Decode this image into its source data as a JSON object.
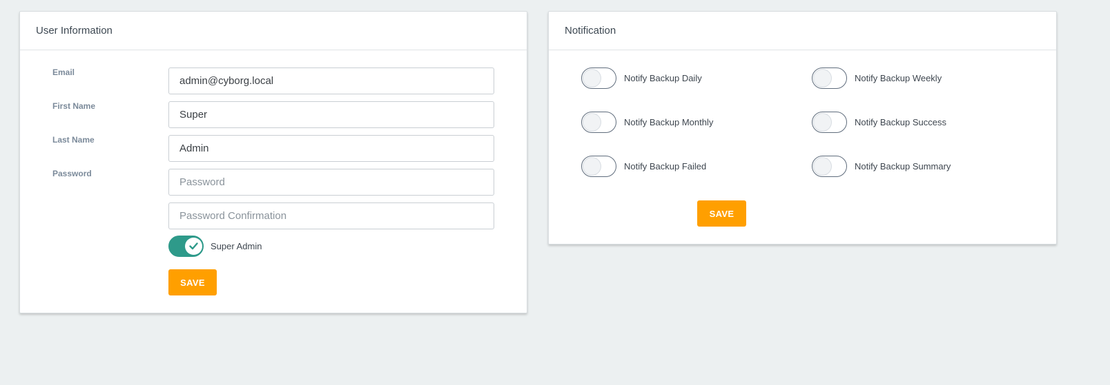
{
  "user_information": {
    "title": "User Information",
    "email": {
      "label": "Email",
      "value": "admin@cyborg.local"
    },
    "first_name": {
      "label": "First Name",
      "value": "Super"
    },
    "last_name": {
      "label": "Last Name",
      "value": "Admin"
    },
    "password": {
      "label": "Password",
      "placeholder": "Password"
    },
    "password_confirmation": {
      "placeholder": "Password Confirmation"
    },
    "super_admin": {
      "label": "Super Admin",
      "checked": true
    },
    "save_label": "SAVE"
  },
  "notification": {
    "title": "Notification",
    "toggles": [
      {
        "label": "Notify Backup Daily",
        "checked": false
      },
      {
        "label": "Notify Backup Weekly",
        "checked": false
      },
      {
        "label": "Notify Backup Monthly",
        "checked": false
      },
      {
        "label": "Notify Backup Success",
        "checked": false
      },
      {
        "label": "Notify Backup Failed",
        "checked": false
      },
      {
        "label": "Notify Backup Summary",
        "checked": false
      }
    ],
    "save_label": "SAVE"
  },
  "colors": {
    "background": "#ecf0f1",
    "accent": "#ff9f00",
    "toggle_on": "#2e9a8a",
    "label_text": "#7b8a9a"
  }
}
